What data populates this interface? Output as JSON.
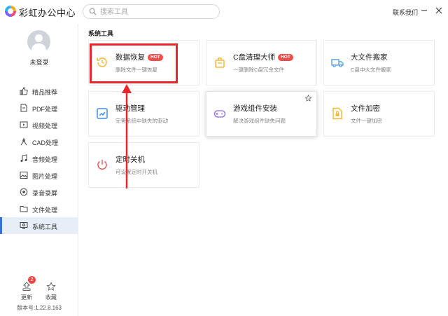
{
  "app": {
    "title": "彩虹办公中心"
  },
  "search": {
    "placeholder": "搜索工具"
  },
  "header": {
    "contact_label": "联系我们"
  },
  "user": {
    "status": "未登录"
  },
  "sidebar": {
    "items": [
      {
        "label": "精品推荐",
        "icon": "like-icon"
      },
      {
        "label": "PDF处理",
        "icon": "pdf-icon"
      },
      {
        "label": "视频处理",
        "icon": "video-icon"
      },
      {
        "label": "CAD处理",
        "icon": "cad-icon"
      },
      {
        "label": "音频处理",
        "icon": "music-icon"
      },
      {
        "label": "图片处理",
        "icon": "image-icon"
      },
      {
        "label": "录音录屏",
        "icon": "record-icon"
      },
      {
        "label": "文件处理",
        "icon": "folder-icon"
      },
      {
        "label": "系统工具",
        "icon": "system-icon"
      }
    ],
    "active_index": 8
  },
  "bottom": {
    "update_label": "更新",
    "update_badge": "2",
    "favorite_label": "收藏",
    "version": "版本号:1.22.8.163"
  },
  "main": {
    "section_title": "系统工具",
    "tools": [
      {
        "title": "数据恢复",
        "desc": "删除文件一键恢复",
        "hot": "HOT",
        "icon": "data-recovery-icon",
        "color": "#f5b937"
      },
      {
        "title": "C盘清理大师",
        "desc": "一键删除C盘冗余文件",
        "hot": "HOT",
        "icon": "disk-cleaner-icon",
        "color": "#f5b937"
      },
      {
        "title": "大文件搬家",
        "desc": "C盘中大文件搬家",
        "icon": "truck-icon",
        "color": "#5aa0e8"
      },
      {
        "title": "驱动管理",
        "desc": "完善系统中缺失的驱动",
        "icon": "driver-icon",
        "color": "#3d8fe0"
      },
      {
        "title": "游戏组件安装",
        "desc": "解决游戏组件缺失问题",
        "icon": "gamepad-icon",
        "color": "#9a7be0"
      },
      {
        "title": "文件加密",
        "desc": "文件一键加密",
        "icon": "file-lock-icon",
        "color": "#f5b937"
      },
      {
        "title": "定时关机",
        "desc": "可设置定时开关机",
        "icon": "power-icon",
        "color": "#e85a5a"
      }
    ]
  },
  "colors": {
    "accent": "#3b6fd8",
    "highlight": "#e8262c",
    "hot_badge": "#f24b4b"
  }
}
